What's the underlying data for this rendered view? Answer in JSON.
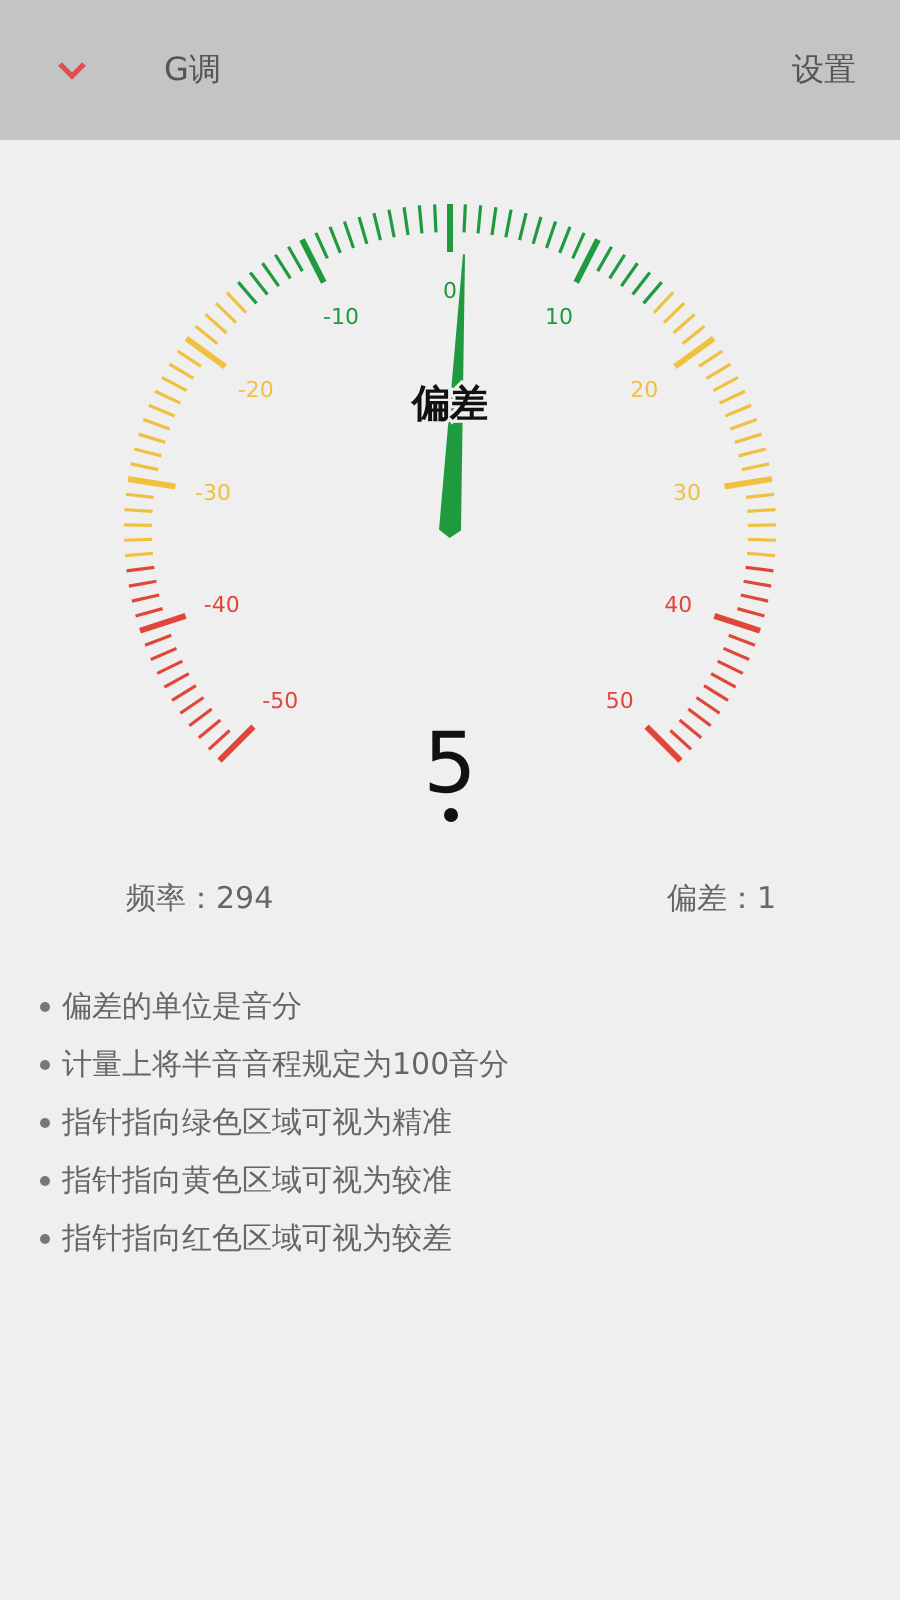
{
  "header": {
    "title": "G调",
    "action": "设置"
  },
  "gauge": {
    "caption": "偏差",
    "level": 0.51,
    "scale_labels": [
      {
        "text": "-50",
        "color": "#e0473a"
      },
      {
        "text": "-40",
        "color": "#e0473a"
      },
      {
        "text": "-30",
        "color": "#f0c040"
      },
      {
        "text": "-20",
        "color": "#f0c040"
      },
      {
        "text": "-10",
        "color": "#1f9a3f"
      },
      {
        "text": "0",
        "color": "#1f9a3f"
      },
      {
        "text": "10",
        "color": "#1f9a3f"
      },
      {
        "text": "20",
        "color": "#f0c040"
      },
      {
        "text": "30",
        "color": "#f0c040"
      },
      {
        "text": "40",
        "color": "#e0473a"
      },
      {
        "text": "50",
        "color": "#e0473a"
      }
    ],
    "reading": "5"
  },
  "stats": [
    {
      "text": "频率：294"
    },
    {
      "text": "偏差：1"
    }
  ],
  "notes": [
    "偏差的单位是音分",
    "计量上将半音音程规定为100音分",
    "指针指向绿色区域可视为精准",
    "指针指向黄色区域可视为较准",
    "指针指向红色区域可视为较差"
  ]
}
